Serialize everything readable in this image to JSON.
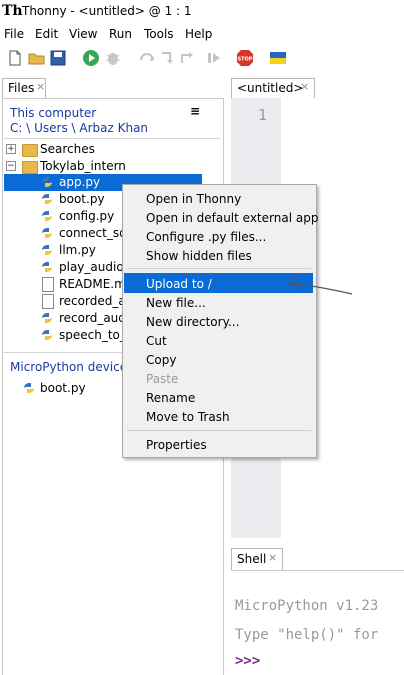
{
  "window": {
    "title": "Thonny  -  <untitled>  @  1 : 1",
    "logo_text": "Th"
  },
  "menubar": [
    "File",
    "Edit",
    "View",
    "Run",
    "Tools",
    "Help"
  ],
  "toolbar": {
    "icons": [
      "new-file-icon",
      "open-folder-icon",
      "save-icon",
      "run-icon",
      "debug-icon",
      "step-over-icon",
      "step-into-icon",
      "step-out-icon",
      "resume-icon",
      "stop-icon",
      "flag-icon"
    ],
    "stop_label": "STOP"
  },
  "files": {
    "tab_label": "Files",
    "tab_close": "×",
    "computer": {
      "title": "This computer",
      "menu_glyph": "≡",
      "path": "C: \\ Users \\ Arbaz Khan"
    },
    "tree": [
      {
        "label": "Searches",
        "kind": "folder",
        "expander": "+"
      },
      {
        "label": "Tokylab_intern",
        "kind": "folder",
        "expander": "−"
      }
    ],
    "items": [
      {
        "label": "app.py",
        "kind": "py",
        "selected": true
      },
      {
        "label": "boot.py",
        "kind": "py"
      },
      {
        "label": "config.py",
        "kind": "py"
      },
      {
        "label": "connect_sd_",
        "kind": "py"
      },
      {
        "label": "llm.py",
        "kind": "py"
      },
      {
        "label": "play_audio_",
        "kind": "py"
      },
      {
        "label": "README.mc",
        "kind": "file"
      },
      {
        "label": "recorded_au",
        "kind": "file"
      },
      {
        "label": "record_audi",
        "kind": "py"
      },
      {
        "label": "speech_to_t",
        "kind": "py"
      }
    ],
    "device": {
      "title": "MicroPython device",
      "items": [
        {
          "label": "boot.py",
          "kind": "py"
        }
      ]
    }
  },
  "editor": {
    "tab_label": "<untitled>",
    "tab_close": "×",
    "line_number": "1"
  },
  "shell": {
    "tab_label": "Shell",
    "tab_close": "×",
    "lines": [
      "MicroPython v1.23",
      "Type \"help()\" for"
    ],
    "prompt": ">>>"
  },
  "context_menu": {
    "items": [
      "Open in Thonny",
      "Open in default external app",
      "Configure .py files...",
      "Show hidden files",
      "Upload to /",
      "New file...",
      "New directory...",
      "Cut",
      "Copy",
      "Paste",
      "Rename",
      "Move to Trash",
      "Properties"
    ],
    "highlighted_index": 4,
    "disabled_index": 9
  },
  "colors": {
    "selection": "#0a6ad6",
    "link_blue": "#1a3aa0",
    "prompt": "#7a2a8a",
    "gutter": "#e9ebef"
  }
}
